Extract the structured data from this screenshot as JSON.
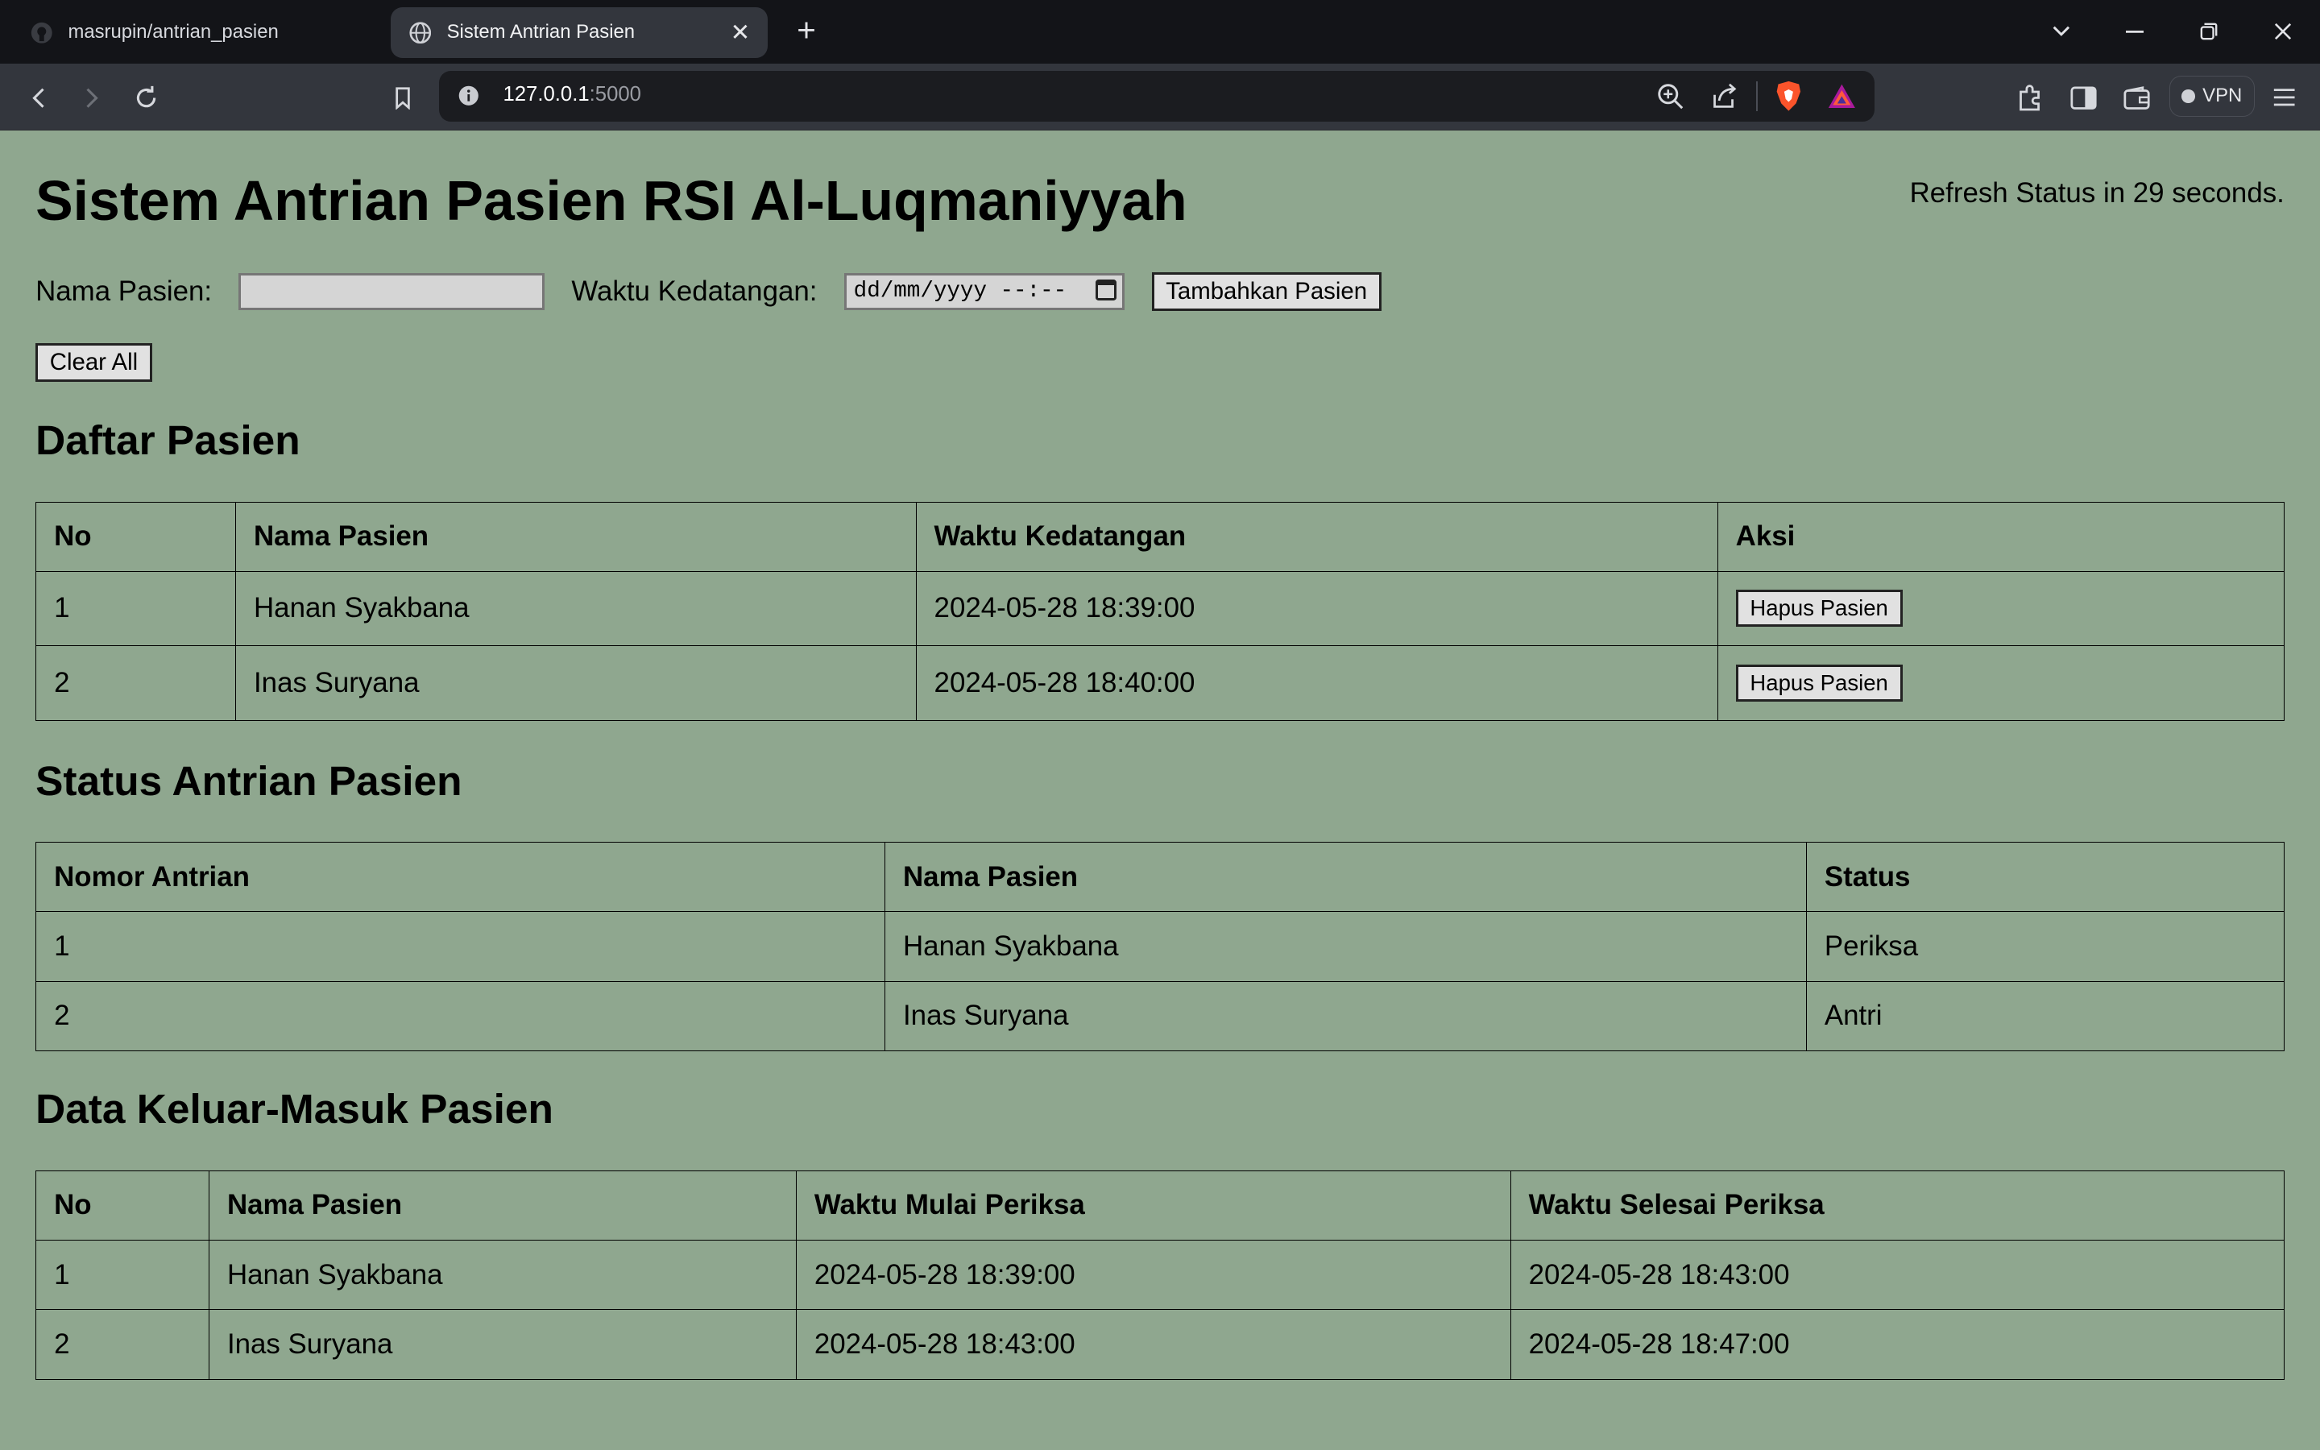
{
  "browser": {
    "tabs": [
      {
        "title": "masrupin/antrian_pasien",
        "active": false
      },
      {
        "title": "Sistem Antrian Pasien",
        "active": true
      }
    ],
    "url_host": "127.0.0.1",
    "url_port": ":5000",
    "vpn_label": "VPN"
  },
  "page": {
    "title": "Sistem Antrian Pasien RSI Al-Luqmaniyyah",
    "refresh_text": "Refresh Status in 29 seconds.",
    "form": {
      "name_label": "Nama Pasien:",
      "name_value": "",
      "time_label": "Waktu Kedatangan:",
      "time_placeholder": "dd/mm/yyyy --:--",
      "add_button": "Tambahkan Pasien"
    },
    "clear_button": "Clear All"
  },
  "daftar": {
    "heading": "Daftar Pasien",
    "headers": [
      "No",
      "Nama Pasien",
      "Waktu Kedatangan",
      "Aksi"
    ],
    "rows": [
      {
        "no": "1",
        "nama": "Hanan Syakbana",
        "waktu": "2024-05-28 18:39:00",
        "aksi": "Hapus Pasien"
      },
      {
        "no": "2",
        "nama": "Inas Suryana",
        "waktu": "2024-05-28 18:40:00",
        "aksi": "Hapus Pasien"
      }
    ]
  },
  "status": {
    "heading": "Status Antrian Pasien",
    "headers": [
      "Nomor Antrian",
      "Nama Pasien",
      "Status"
    ],
    "rows": [
      {
        "nomor": "1",
        "nama": "Hanan Syakbana",
        "status": "Periksa"
      },
      {
        "nomor": "2",
        "nama": "Inas Suryana",
        "status": "Antri"
      }
    ]
  },
  "keluarmasuk": {
    "heading": "Data Keluar-Masuk Pasien",
    "headers": [
      "No",
      "Nama Pasien",
      "Waktu Mulai Periksa",
      "Waktu Selesai Periksa"
    ],
    "rows": [
      {
        "no": "1",
        "nama": "Hanan Syakbana",
        "mulai": "2024-05-28 18:39:00",
        "selesai": "2024-05-28 18:43:00"
      },
      {
        "no": "2",
        "nama": "Inas Suryana",
        "mulai": "2024-05-28 18:43:00",
        "selesai": "2024-05-28 18:47:00"
      }
    ]
  },
  "colors": {
    "page_bg": "#8fa78f",
    "chrome_dark": "#131418",
    "chrome_toolbar": "#33363d"
  }
}
